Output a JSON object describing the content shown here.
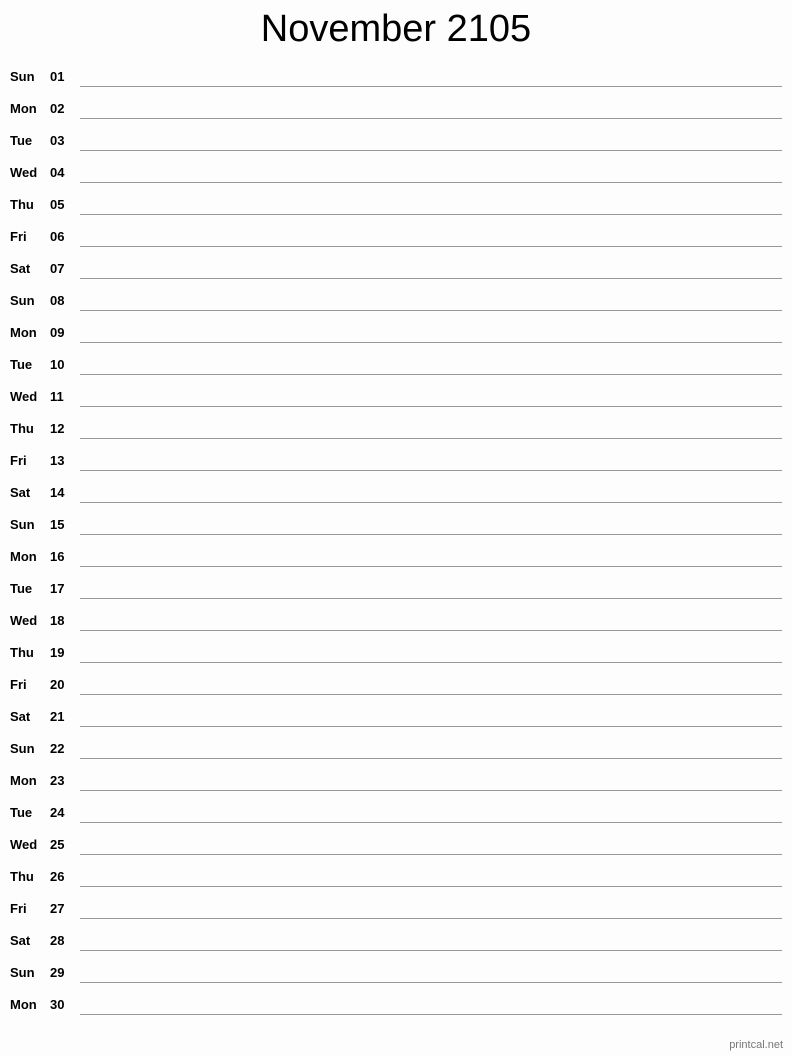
{
  "title": "November 2105",
  "days": [
    {
      "dow": "Sun",
      "num": "01"
    },
    {
      "dow": "Mon",
      "num": "02"
    },
    {
      "dow": "Tue",
      "num": "03"
    },
    {
      "dow": "Wed",
      "num": "04"
    },
    {
      "dow": "Thu",
      "num": "05"
    },
    {
      "dow": "Fri",
      "num": "06"
    },
    {
      "dow": "Sat",
      "num": "07"
    },
    {
      "dow": "Sun",
      "num": "08"
    },
    {
      "dow": "Mon",
      "num": "09"
    },
    {
      "dow": "Tue",
      "num": "10"
    },
    {
      "dow": "Wed",
      "num": "11"
    },
    {
      "dow": "Thu",
      "num": "12"
    },
    {
      "dow": "Fri",
      "num": "13"
    },
    {
      "dow": "Sat",
      "num": "14"
    },
    {
      "dow": "Sun",
      "num": "15"
    },
    {
      "dow": "Mon",
      "num": "16"
    },
    {
      "dow": "Tue",
      "num": "17"
    },
    {
      "dow": "Wed",
      "num": "18"
    },
    {
      "dow": "Thu",
      "num": "19"
    },
    {
      "dow": "Fri",
      "num": "20"
    },
    {
      "dow": "Sat",
      "num": "21"
    },
    {
      "dow": "Sun",
      "num": "22"
    },
    {
      "dow": "Mon",
      "num": "23"
    },
    {
      "dow": "Tue",
      "num": "24"
    },
    {
      "dow": "Wed",
      "num": "25"
    },
    {
      "dow": "Thu",
      "num": "26"
    },
    {
      "dow": "Fri",
      "num": "27"
    },
    {
      "dow": "Sat",
      "num": "28"
    },
    {
      "dow": "Sun",
      "num": "29"
    },
    {
      "dow": "Mon",
      "num": "30"
    }
  ],
  "footer": "printcal.net"
}
